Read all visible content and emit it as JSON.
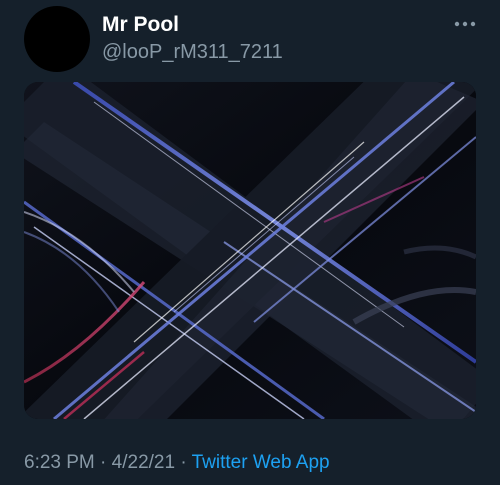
{
  "tweet": {
    "user": {
      "display_name": "Mr Pool",
      "handle": "@looP_rM311_7211"
    },
    "media": {
      "alt": ""
    },
    "meta": {
      "time": "6:23 PM",
      "separator": "·",
      "date": "4/22/21",
      "source": "Twitter Web App"
    },
    "menu_icon": "more-dots-icon"
  },
  "colors": {
    "background": "#15202b",
    "primary_text": "#ffffff",
    "secondary_text": "#8899a6",
    "link": "#1da1f2"
  }
}
